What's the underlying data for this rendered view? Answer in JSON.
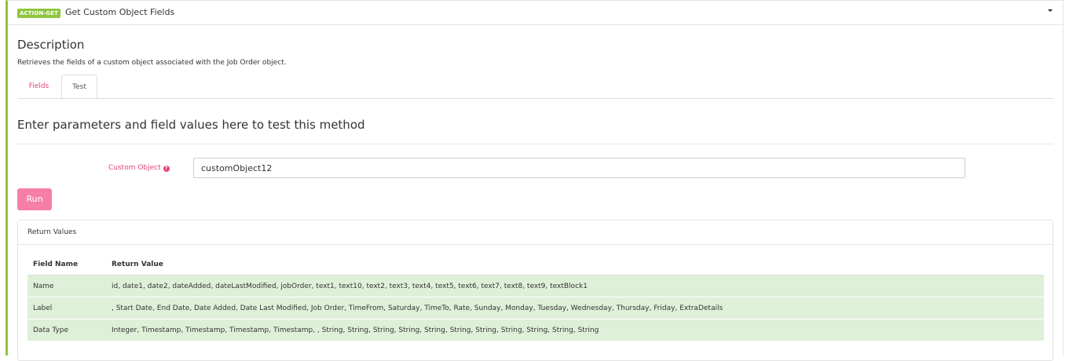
{
  "header": {
    "badge": "ACTION-GET",
    "title": "Get Custom Object Fields"
  },
  "description": {
    "heading": "Description",
    "text": "Retrieves the fields of a custom object associated with the Job Order object."
  },
  "tabs": [
    {
      "label": "Fields",
      "active": false
    },
    {
      "label": "Test",
      "active": true
    }
  ],
  "test": {
    "heading": "Enter parameters and field values here to test this method",
    "param_label": "Custom Object",
    "param_value": "customObject12",
    "run_label": "Run"
  },
  "return_values": {
    "title": "Return Values",
    "columns": [
      "Field Name",
      "Return Value"
    ],
    "rows": [
      {
        "field": "Name",
        "value": "id, date1, date2, dateAdded, dateLastModified, jobOrder, text1, text10, text2, text3, text4, text5, text6, text7, text8, text9, textBlock1"
      },
      {
        "field": "Label",
        "value": ", Start Date, End Date, Date Added, Date Last Modified, Job Order, TimeFrom, Saturday, TimeTo, Rate, Sunday, Monday, Tuesday, Wednesday, Thursday, Friday, ExtraDetails"
      },
      {
        "field": "Data Type",
        "value": "Integer, Timestamp, Timestamp, Timestamp, Timestamp, , String, String, String, String, String, String, String, String, String, String, String"
      }
    ]
  },
  "colors": {
    "accent_green": "#8dc63f",
    "accent_pink": "#e0457b",
    "run_button": "#f57fa6",
    "row_success": "#dff0d8"
  }
}
